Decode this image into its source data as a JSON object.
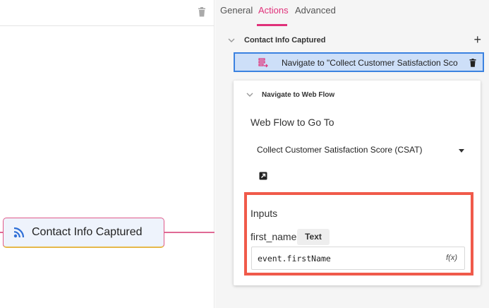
{
  "canvas": {
    "node_label": "Contact Info Captured"
  },
  "tabs": [
    {
      "label": "General"
    },
    {
      "label": "Actions",
      "active": true
    },
    {
      "label": "Advanced"
    }
  ],
  "group": {
    "title": "Contact Info Captured",
    "add_label": "+"
  },
  "action": {
    "label": "Navigate to \"Collect Customer Satisfaction Sco"
  },
  "card": {
    "title": "Navigate to Web Flow",
    "flow_label": "Web Flow to Go To",
    "selected_flow": "Collect Customer Satisfaction Score (CSAT)",
    "inputs_title": "Inputs",
    "param_name": "first_name",
    "param_type": "Text",
    "param_value": "event.firstName",
    "fx_label": "f(x)"
  },
  "colors": {
    "accent": "#e0317a",
    "selection_border": "#3b82e0",
    "selection_fill": "#cddff8",
    "highlight": "#f05a4a",
    "node_fill": "#eef3fc",
    "rss_icon": "#2f6fd6"
  },
  "icons": {
    "canvas_trash": "trash-icon",
    "node": "rss-icon",
    "group_toggle": "chevron-down-icon",
    "action": "navigate-flow-icon",
    "row_trash": "trash-icon",
    "open_flow": "open-external-icon",
    "expression": "fx-icon"
  }
}
